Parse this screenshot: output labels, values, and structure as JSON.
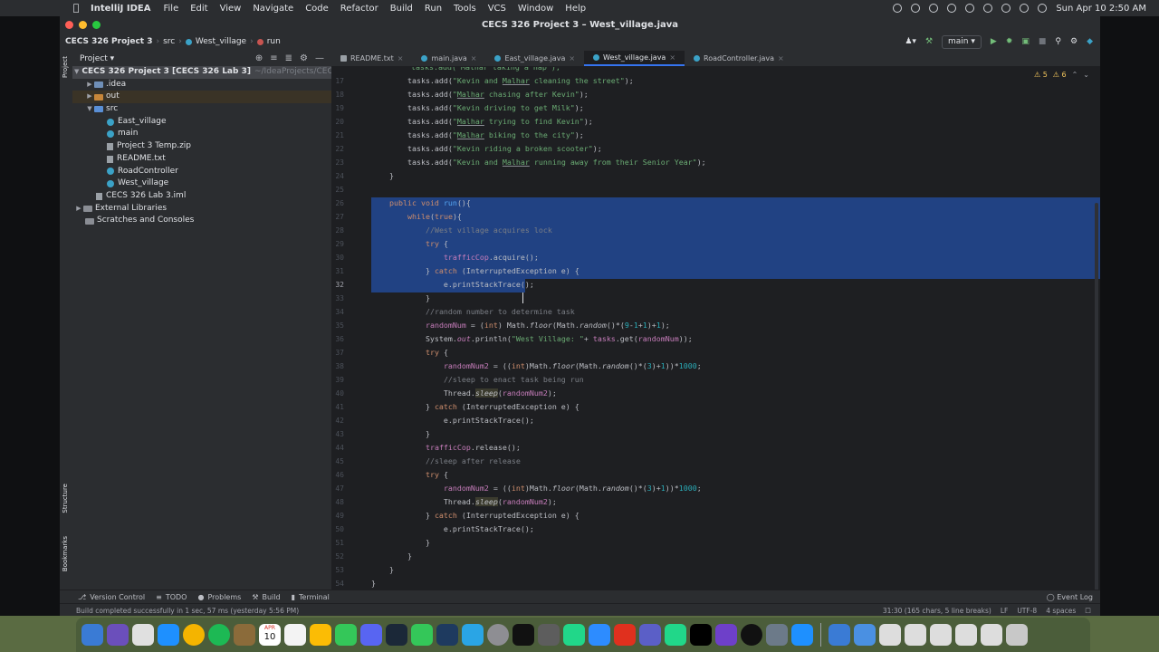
{
  "mac_menubar": {
    "app_name": "IntelliJ IDEA",
    "menus": [
      "File",
      "Edit",
      "View",
      "Navigate",
      "Code",
      "Refactor",
      "Build",
      "Run",
      "Tools",
      "VCS",
      "Window",
      "Help"
    ],
    "clock": "Sun Apr 10  2:50 AM"
  },
  "window": {
    "title": "CECS 326 Project 3 – West_village.java"
  },
  "navbar": {
    "project": "CECS 326 Project 3",
    "src": "src",
    "file": "West_village",
    "member": "run",
    "branch": "main"
  },
  "project_panel": {
    "header": "Project",
    "root_label": "CECS 326 Project 3 [CECS 326 Lab 3]",
    "root_path": "~/IdeaProjects/CECS",
    "idea": ".idea",
    "out": "out",
    "src": "src",
    "src_items": [
      "East_village",
      "main",
      "Project 3 Temp.zip",
      "README.txt",
      "RoadController",
      "West_village"
    ],
    "iml": "CECS 326 Lab 3.iml",
    "external": "External Libraries",
    "scratches": "Scratches and Consoles"
  },
  "tabs": [
    {
      "label": "README.txt",
      "type": "text",
      "active": false
    },
    {
      "label": "main.java",
      "type": "class",
      "active": false
    },
    {
      "label": "East_village.java",
      "type": "class",
      "active": false
    },
    {
      "label": "West_village.java",
      "type": "class",
      "active": true
    },
    {
      "label": "RoadController.java",
      "type": "class",
      "active": false
    }
  ],
  "editor": {
    "warnings": "5",
    "weak_warnings": "6",
    "line_numbers": [
      "17",
      "18",
      "19",
      "20",
      "21",
      "22",
      "23",
      "24",
      "25",
      "26",
      "27",
      "28",
      "29",
      "30",
      "31",
      "32",
      "33",
      "34",
      "35",
      "36",
      "37",
      "38",
      "39",
      "40",
      "41",
      "42",
      "43",
      "44",
      "45",
      "46",
      "47",
      "48",
      "49",
      "50",
      "51",
      "52",
      "53",
      "54"
    ],
    "current_line": "32",
    "first_line_fragment": "tasks.add(\"Malhar taking a nap\");"
  },
  "left_strip": {
    "project": "Project",
    "structure": "Structure",
    "bookmarks": "Bookmarks"
  },
  "tool_windows": {
    "items": [
      "Version Control",
      "TODO",
      "Problems",
      "Build",
      "Terminal"
    ],
    "event_log": "Event Log"
  },
  "status": {
    "message": "Build completed successfully in 1 sec, 57 ms (yesterday 5:56 PM)",
    "position": "31:30 (165 chars, 5 line breaks)",
    "line_sep": "LF",
    "encoding": "UTF-8",
    "indent": "4 spaces"
  },
  "dock": {
    "calendar_month": "APR",
    "calendar_day": "10"
  },
  "colors": {
    "selection": "#214283",
    "keyword": "#cf8e6d",
    "string": "#6aab73",
    "comment": "#7a7e85",
    "field": "#c77dbb"
  }
}
